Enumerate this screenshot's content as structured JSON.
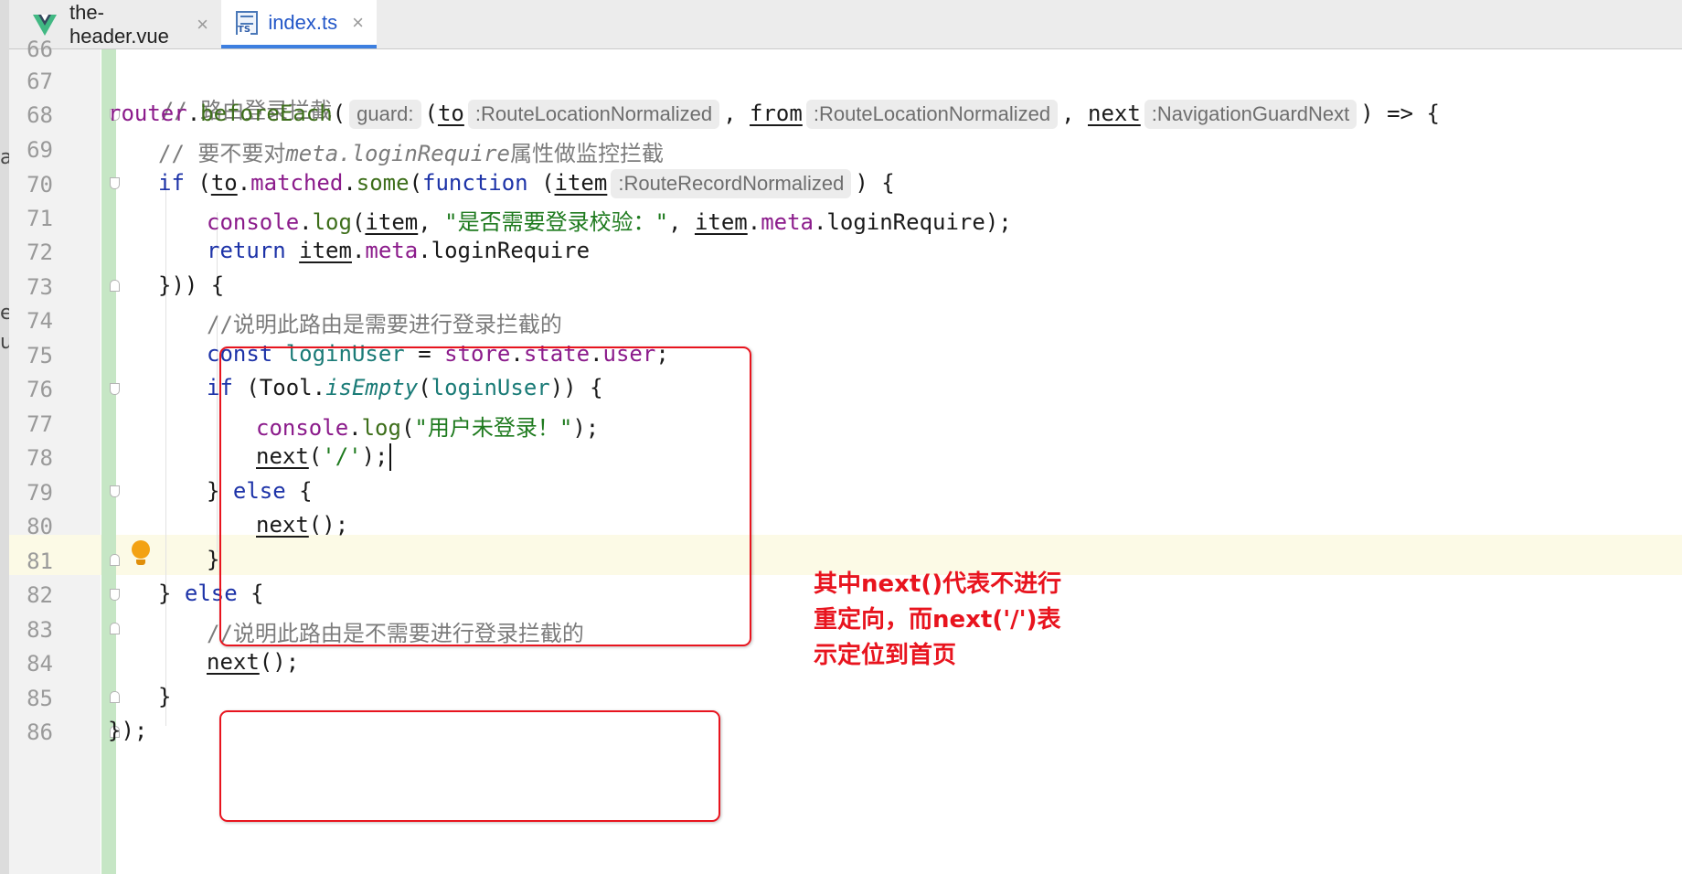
{
  "tabs": [
    {
      "label": "the-header.vue",
      "icon": "vue-logo-icon",
      "active": false,
      "close": "×"
    },
    {
      "label": "index.ts",
      "icon": "typescript-file-icon",
      "active": true,
      "close": "×",
      "icon_text": "TS"
    }
  ],
  "left_strip_fragments": [
    "a",
    "e",
    "u"
  ],
  "line_numbers": [
    "66",
    "67",
    "68",
    "69",
    "70",
    "71",
    "72",
    "73",
    "74",
    "75",
    "76",
    "77",
    "78",
    "79",
    "80",
    "81",
    "82",
    "83",
    "84",
    "85",
    "86"
  ],
  "code": {
    "l67": {
      "comment": "// 路由登录拦截"
    },
    "l68": {
      "router": "router",
      "dot": ".",
      "method": "beforeEach",
      "paren": "(",
      "hint_guard": "guard:",
      "open_p": "(",
      "to": "to",
      "hint_to": ":RouteLocationNormalized",
      "comma1": ",",
      "from": "from",
      "hint_from": ":RouteLocationNormalized",
      "comma2": ",",
      "next": "next",
      "hint_next": ":NavigationGuardNext",
      "tail": ") => {"
    },
    "l69": {
      "prefix": "// 要不要对",
      "italic": "meta.loginRequire",
      "suffix": "属性做监控拦截"
    },
    "l70": {
      "if": "if",
      "sp": " (",
      "to": "to",
      "dot1": ".",
      "matched": "matched",
      "dot2": ".",
      "some": "some",
      "paren": "(",
      "function": "function",
      "sp2": " (",
      "item": "item",
      "hint_item": ":RouteRecordNormalized",
      "tail": ") {"
    },
    "l71": {
      "console": "console",
      "dot": ".",
      "log": "log",
      "paren": "(",
      "item": "item",
      "comma": ", ",
      "str": "\"是否需要登录校验：\"",
      "comma2": ", ",
      "item2": "item",
      "dot2": ".",
      "meta": "meta",
      "rest": ".loginRequire);"
    },
    "l72": {
      "return": "return",
      "sp": " ",
      "item": "item",
      "dot": ".",
      "meta": "meta",
      "rest": ".loginRequire"
    },
    "l73": {
      "text": "})) {"
    },
    "l74": {
      "comment": "//说明此路由是需要进行登录拦截的"
    },
    "l75": {
      "const": "const",
      "sp": " ",
      "loginUser": "loginUser",
      "eq": " = ",
      "store": "store",
      "dot1": ".",
      "state": "state",
      "dot2": ".",
      "user": "user",
      "semi": ";"
    },
    "l76": {
      "if": "if",
      "open": " (Tool.",
      "isEmpty": "isEmpty",
      "p": "(",
      "loginUser": "loginUser",
      "tail": ")) {"
    },
    "l77": {
      "console": "console",
      "dot": ".",
      "log": "log",
      "p": "(",
      "str": "\"用户未登录！\"",
      "tail": ");"
    },
    "l78": {
      "next": "next",
      "p": "(",
      "str": "'/'",
      "tail": ");"
    },
    "l79": {
      "close": "} ",
      "else": "else",
      "tail": " {"
    },
    "l80": {
      "next": "next",
      "tail": "();"
    },
    "l81": {
      "text": "}"
    },
    "l82": {
      "close": "} ",
      "else": "else",
      "tail": " {"
    },
    "l83": {
      "comment": "//说明此路由是不需要进行登录拦截的"
    },
    "l84": {
      "next": "next",
      "tail": "();"
    },
    "l85": {
      "text": "}"
    },
    "l86": {
      "text": "});"
    }
  },
  "annotation": {
    "lines": [
      "其中next()代表不进行",
      "重定向，而next('/')表",
      "示定位到首页"
    ]
  },
  "colors": {
    "keyword": "#1d33a8",
    "function": "#3d6e1a",
    "property": "#8b1b8b",
    "local": "#1a7b77",
    "string": "#1e7a1e",
    "comment": "#7c7c7c",
    "annotation": "#e8141e",
    "tab_active": "#3d7fe0"
  }
}
